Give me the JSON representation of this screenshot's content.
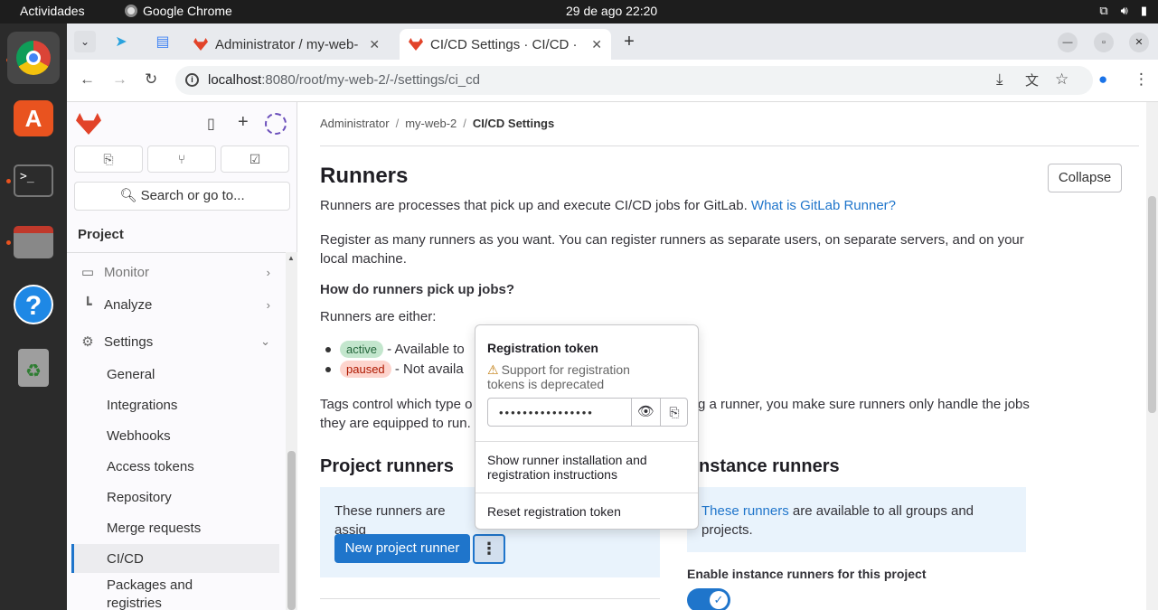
{
  "os": {
    "activities": "Actividades",
    "app_name": "Google Chrome",
    "clock": "29 de ago  22:20"
  },
  "browser": {
    "tabs": [
      {
        "label": "Administrator / my-web-"
      },
      {
        "label": "CI/CD Settings · CI/CD · S"
      }
    ],
    "url_host": "localhost",
    "url_path": ":8080/root/my-web-2/-/settings/ci_cd"
  },
  "sidebar": {
    "search_label": "Search or go to...",
    "heading": "Project",
    "items": [
      {
        "label": "Monitor",
        "icon": "monitor-icon"
      },
      {
        "label": "Analyze",
        "icon": "chart-icon"
      },
      {
        "label": "Settings",
        "icon": "gear-icon"
      }
    ],
    "sub_items": [
      {
        "label": "General"
      },
      {
        "label": "Integrations"
      },
      {
        "label": "Webhooks"
      },
      {
        "label": "Access tokens"
      },
      {
        "label": "Repository"
      },
      {
        "label": "Merge requests"
      },
      {
        "label": "CI/CD"
      },
      {
        "label": "Packages and registries"
      }
    ]
  },
  "breadcrumb": [
    "Administrator",
    "my-web-2",
    "CI/CD Settings"
  ],
  "runners": {
    "title": "Runners",
    "collapse_label": "Collapse",
    "intro": "Runners are processes that pick up and execute CI/CD jobs for GitLab.",
    "intro_link": "What is GitLab Runner?",
    "register_text": "Register as many runners as you want. You can register runners as separate users, on separate servers, and on your local machine.",
    "how_heading": "How do runners pick up jobs?",
    "either_text": "Runners are either:",
    "active_badge": "active",
    "active_text": "- Available to",
    "paused_badge": "paused",
    "paused_text": "- Not availa",
    "tags_text_a": "Tags control which type o",
    "tags_text_b": "g a runner, you make sure runners only handle the jobs",
    "tags_text_c": "they are equipped to run."
  },
  "project_runners": {
    "title": "Project runners",
    "info_text": "These runners are assig",
    "new_button": "New project runner"
  },
  "instance_runners": {
    "title": "nstance runners",
    "info_link": "These runners",
    "info_text_a": " are available to all groups and",
    "info_text_b": "projects.",
    "toggle_label": "Enable instance runners for this project",
    "toggle_on": true
  },
  "popover": {
    "title": "Registration token",
    "warning": "Support for registration tokens is deprecated",
    "token_mask": "••••••••••••••••",
    "menu_install": "Show runner installation and registration instructions",
    "menu_reset": "Reset registration token"
  },
  "colors": {
    "accent": "#1f75cb",
    "gitlab_orange": "#e24329",
    "active_badge_bg": "#c3e6cd",
    "paused_badge_bg": "#fdd4cd"
  }
}
